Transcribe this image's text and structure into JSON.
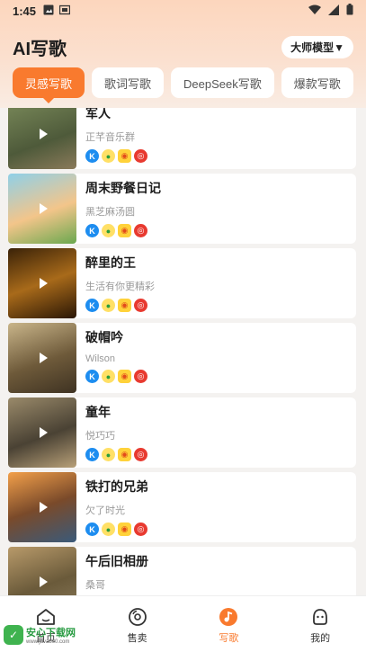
{
  "status_bar": {
    "time": "1:45"
  },
  "header": {
    "title": "AI写歌",
    "model_button": "大师模型▼"
  },
  "tabs": [
    {
      "label": "灵感写歌",
      "active": true
    },
    {
      "label": "歌词写歌",
      "active": false
    },
    {
      "label": "DeepSeek写歌",
      "active": false
    },
    {
      "label": "爆款写歌",
      "active": false
    }
  ],
  "songs": [
    {
      "title": "军人",
      "artist": "正芊音乐群"
    },
    {
      "title": "周末野餐日记",
      "artist": "黑芝麻汤圆"
    },
    {
      "title": "醉里的王",
      "artist": "生活有你更精彩"
    },
    {
      "title": "破帽吟",
      "artist": "Wilson"
    },
    {
      "title": "童年",
      "artist": "悦巧巧"
    },
    {
      "title": "铁打的兄弟",
      "artist": "欠了时光"
    },
    {
      "title": "午后旧相册",
      "artist": "桑哥"
    }
  ],
  "platform_icons": [
    "kugou-icon",
    "qq-music-icon",
    "kuwo-icon",
    "netease-music-icon"
  ],
  "bottom_nav": [
    {
      "label": "首页",
      "icon": "home-icon",
      "active": false
    },
    {
      "label": "售卖",
      "icon": "disc-icon",
      "active": false
    },
    {
      "label": "写歌",
      "icon": "music-note-icon",
      "active": true
    },
    {
      "label": "我的",
      "icon": "profile-icon",
      "active": false
    }
  ],
  "watermark": {
    "main": "安心下载网",
    "sub": "www.java800.com"
  },
  "colors": {
    "accent": "#f97a2e",
    "header_bg": "#fcd6bd"
  }
}
